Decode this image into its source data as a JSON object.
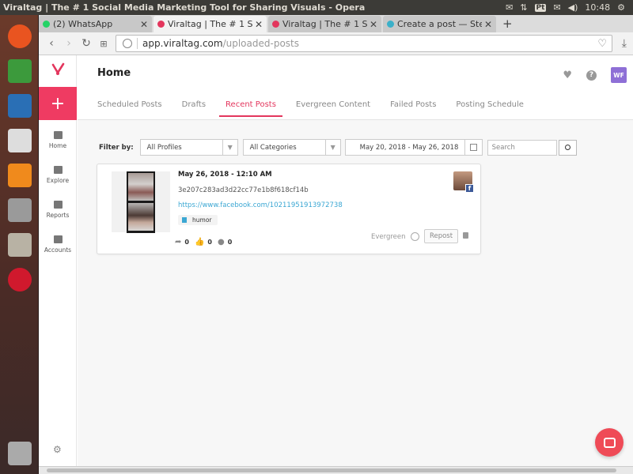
{
  "os": {
    "window_title": "Viraltag | The # 1 Social Media Marketing Tool for Sharing Visuals - Opera",
    "clock": "10:48",
    "keyboard_layout": "Pt"
  },
  "browser": {
    "tabs": [
      {
        "label": "(2) WhatsApp",
        "color": "#25d366",
        "active": false
      },
      {
        "label": "Viraltag | The # 1 Soc",
        "color": "#e3365d",
        "active": true
      },
      {
        "label": "Viraltag | The # 1 Soc",
        "color": "#e3365d",
        "active": false
      },
      {
        "label": "Create a post — Stee",
        "color": "#3bb0c9",
        "active": false
      }
    ],
    "url_domain": "app.viraltag.com",
    "url_path": "/uploaded-posts"
  },
  "app": {
    "sidebar": {
      "items": [
        {
          "label": "Home"
        },
        {
          "label": "Explore"
        },
        {
          "label": "Reports"
        },
        {
          "label": "Accounts"
        }
      ]
    },
    "header": {
      "title": "Home",
      "avatar_initials": "WF"
    },
    "tabs": [
      {
        "label": "Scheduled Posts"
      },
      {
        "label": "Drafts"
      },
      {
        "label": "Recent Posts"
      },
      {
        "label": "Evergreen Content"
      },
      {
        "label": "Failed Posts"
      },
      {
        "label": "Posting Schedule"
      }
    ],
    "filters": {
      "label": "Filter by:",
      "profiles": "All Profiles",
      "categories": "All Categories",
      "date_range": "May 20, 2018 - May 26, 2018",
      "search_placeholder": "Search"
    },
    "post": {
      "date": "May 26, 2018 - 12:10 AM",
      "hash": "3e207c283ad3d22cc77e1b8f618cf14b",
      "link": "https://www.facebook.com/10211951913972738",
      "tag": "humor",
      "shares": "0",
      "likes": "0",
      "comments": "0",
      "evergreen_label": "Evergreen",
      "repost_label": "Repost",
      "network_badge": "f"
    }
  },
  "colors": {
    "brand": "#e3365d",
    "link": "#3ba7d3"
  }
}
